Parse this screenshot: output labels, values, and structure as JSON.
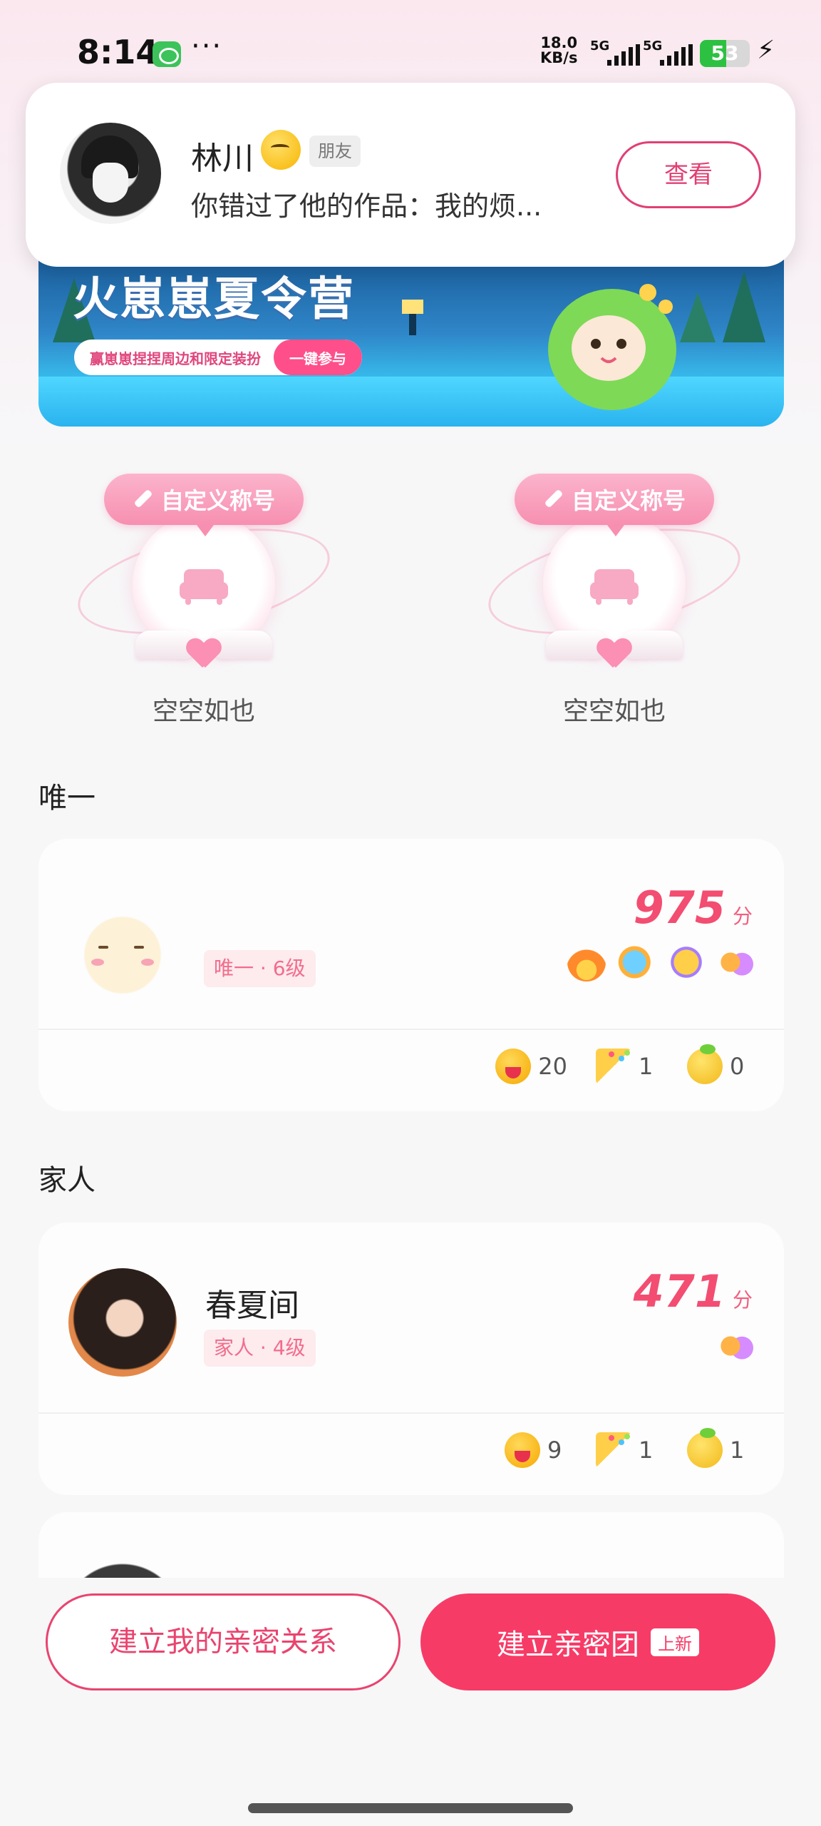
{
  "status_bar": {
    "time": "8:14",
    "dots": "···",
    "speed_top": "18.0",
    "speed_bottom": "KB/s",
    "sim1": "5G",
    "sim2": "5G",
    "battery": "53",
    "battery_level": 0.53
  },
  "notification": {
    "name": "林川",
    "emoji_icon": "thinking-face-icon",
    "tag": "朋友",
    "message": "你错过了他的作品：我的烦...",
    "button": "查看"
  },
  "banner": {
    "title": "火崽崽夏令营",
    "subtitle": "赢崽崽捏捏周边和限定装扮",
    "cta": "一键参与"
  },
  "seats": [
    {
      "label": "自定义称号",
      "empty_text": "空空如也"
    },
    {
      "label": "自定义称号",
      "empty_text": "空空如也"
    }
  ],
  "sections": {
    "unique": "唯一",
    "family": "家人"
  },
  "cards": [
    {
      "name": "",
      "badge": "唯一 · 6级",
      "score": "975",
      "unit": "分",
      "icons": [
        "fire-icon",
        "horn-icon",
        "phone-icon",
        "hug-icon"
      ],
      "stats": [
        {
          "icon": "love-face-icon",
          "count": "20"
        },
        {
          "icon": "party-popper-icon",
          "count": "1"
        },
        {
          "icon": "lemon-face-icon",
          "count": "0"
        }
      ]
    },
    {
      "name": "春夏间",
      "badge": "家人 · 4级",
      "score": "471",
      "unit": "分",
      "icons": [
        "hug-icon"
      ],
      "stats": [
        {
          "icon": "love-face-icon",
          "count": "9"
        },
        {
          "icon": "party-popper-icon",
          "count": "1"
        },
        {
          "icon": "lemon-face-icon",
          "count": "1"
        }
      ]
    }
  ],
  "bottom": {
    "left_button": "建立我的亲密关系",
    "right_button": "建立亲密团",
    "right_badge": "上新"
  },
  "colors": {
    "accent": "#f73b67",
    "score": "#f34d72"
  }
}
